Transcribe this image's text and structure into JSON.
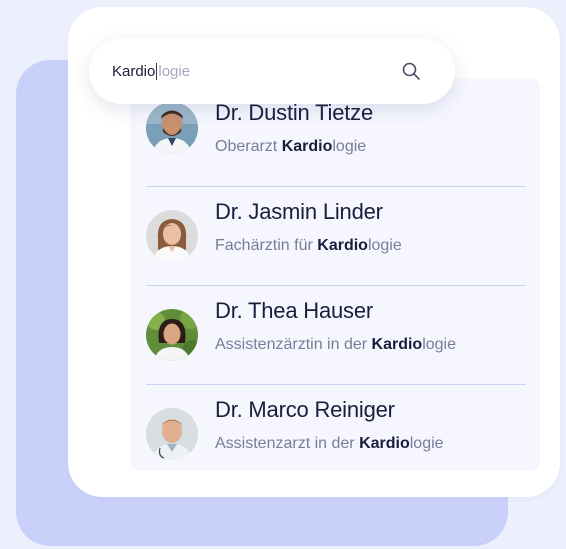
{
  "search": {
    "typed": "Kardio",
    "suggestion": "logie",
    "icon": "search-icon"
  },
  "results": [
    {
      "name": "Dr. Dustin Tietze",
      "prefix": "Oberarzt ",
      "highlight": "Kardio",
      "suffix": "logie"
    },
    {
      "name": "Dr. Jasmin Linder",
      "prefix": "Fachärztin für ",
      "highlight": "Kardio",
      "suffix": "logie"
    },
    {
      "name": "Dr. Thea Hauser",
      "prefix": "Assistenzärztin in der ",
      "highlight": "Kardio",
      "suffix": "logie"
    },
    {
      "name": "Dr. Marco Reiniger",
      "prefix": "Assistenzarzt in der ",
      "highlight": "Kardio",
      "suffix": "logie"
    }
  ],
  "colors": {
    "background": "#eceffc",
    "back_card": "#c9d1fb",
    "panel": "#f5f6fe",
    "divider": "#cfd2f2",
    "name_text": "#1b1d3d",
    "sub_text": "#7a7d99"
  }
}
